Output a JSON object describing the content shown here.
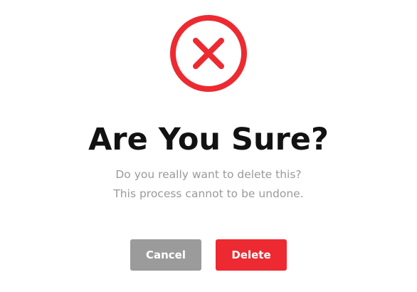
{
  "dialog": {
    "icon": "close-circle-icon",
    "title": "Are You Sure?",
    "message_lines": [
      "Do you really want to delete this?",
      "This process cannot to be undone."
    ],
    "cancel_label": "Cancel",
    "delete_label": "Delete"
  },
  "colors": {
    "danger": "#ed2a31",
    "cancel": "#9b9b9b",
    "title": "#121212",
    "message": "#9a9a9a"
  }
}
